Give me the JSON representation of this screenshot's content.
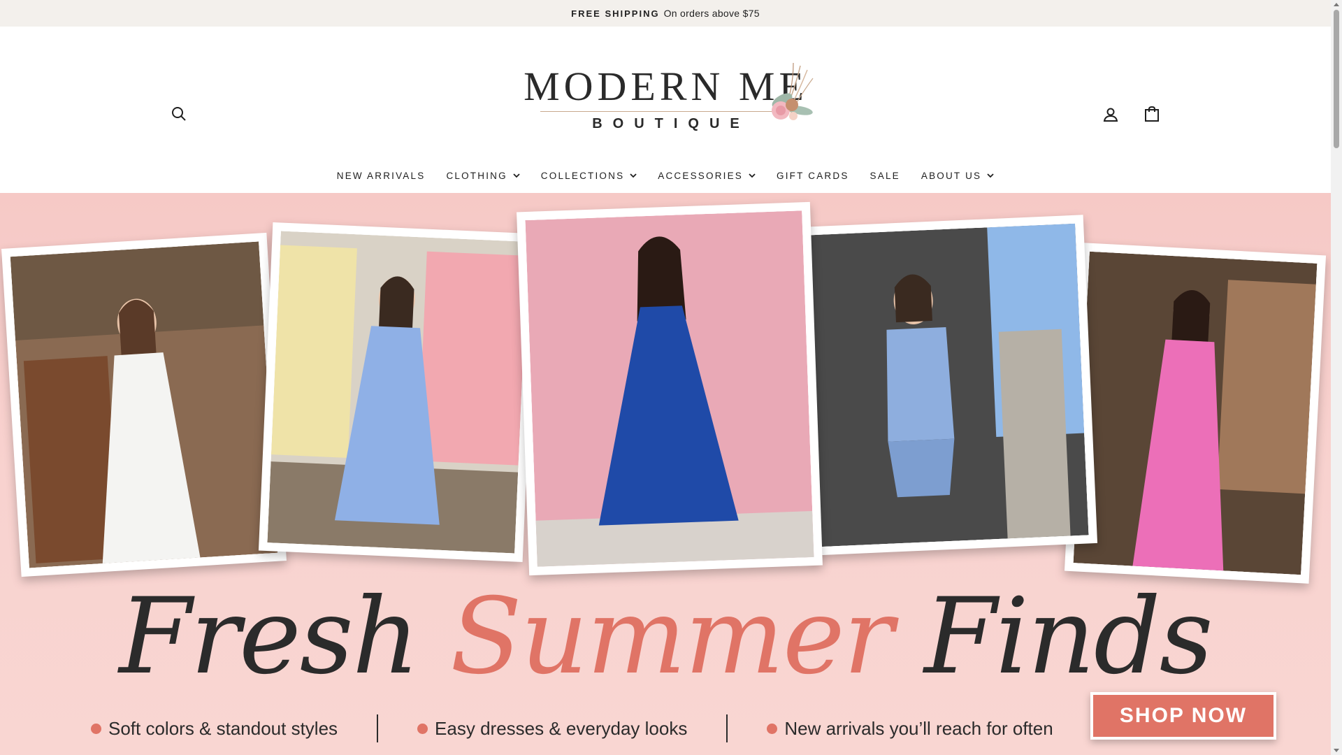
{
  "announcement": {
    "strong": "FREE SHIPPING",
    "text": "On orders above $75"
  },
  "header": {
    "logo_main": "MODERN ME",
    "logo_sub": "BOUTIQUE",
    "search_icon": "search-icon",
    "account_icon": "account-icon",
    "cart_icon": "shopping-bag-icon"
  },
  "nav": {
    "items": [
      {
        "label": "NEW ARRIVALS",
        "dropdown": false
      },
      {
        "label": "CLOTHING",
        "dropdown": true
      },
      {
        "label": "COLLECTIONS",
        "dropdown": true
      },
      {
        "label": "ACCESSORIES",
        "dropdown": true
      },
      {
        "label": "GIFT CARDS",
        "dropdown": false
      },
      {
        "label": "SALE",
        "dropdown": false
      },
      {
        "label": "ABOUT US",
        "dropdown": true
      }
    ]
  },
  "hero": {
    "title_part1": "Fresh",
    "title_accent": "Summer",
    "title_part2": "Finds",
    "bullets": [
      "Soft colors & standout styles",
      "Easy dresses & everyday looks",
      "New arrivals you’ll reach for often"
    ],
    "cta": "SHOP NOW",
    "photos": [
      {
        "dress_color": "#f4f4f2",
        "bg_color": "#8a6a52"
      },
      {
        "dress_color": "#8fb0e6",
        "bg_color": "#d9d2c6"
      },
      {
        "dress_color": "#1f4aa8",
        "bg_color": "#e9a9b6"
      },
      {
        "dress_color": "#8eaede",
        "bg_color": "#4a4a4a"
      },
      {
        "dress_color": "#ec6fb8",
        "bg_color": "#5a4636"
      }
    ]
  },
  "colors": {
    "accent": "#e07466",
    "announcement_bg": "#f3f0ec",
    "hero_bg": "#f8d2cf"
  }
}
